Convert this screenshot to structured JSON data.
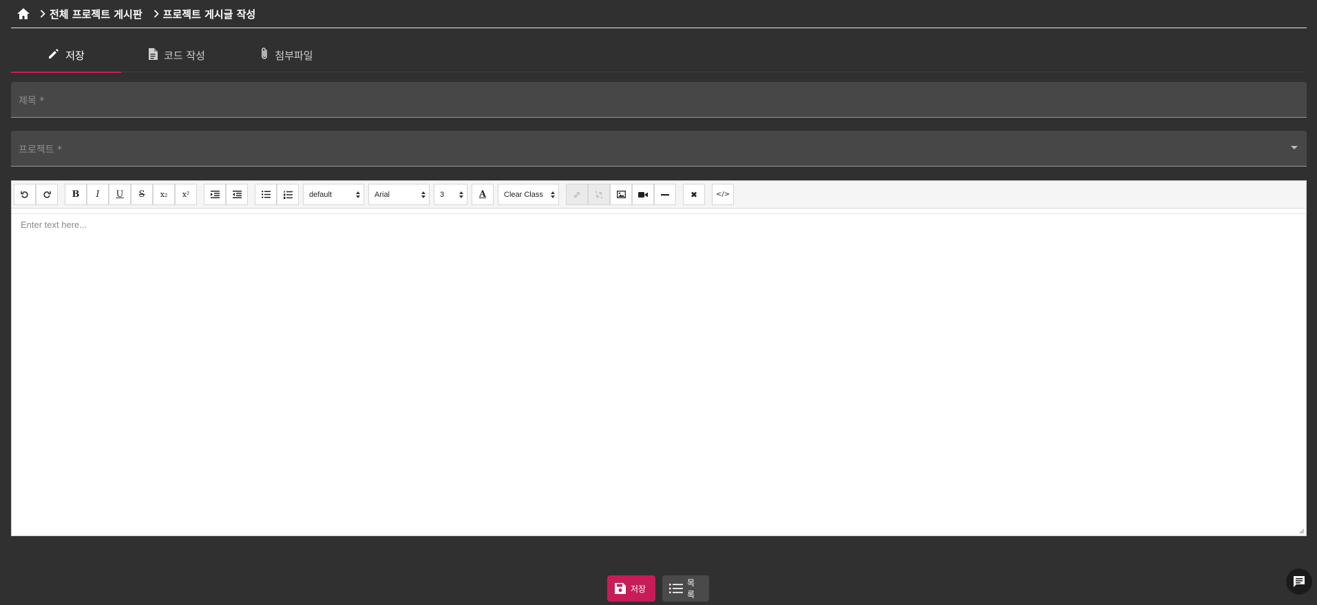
{
  "breadcrumb": {
    "items": [
      "전체 프로젝트 게시판",
      "프로젝트 게시글 작성"
    ]
  },
  "tabs": [
    {
      "label": "저장",
      "icon": "pencil-icon",
      "active": true
    },
    {
      "label": "코드 작성",
      "icon": "document-icon",
      "active": false
    },
    {
      "label": "첨부파일",
      "icon": "paperclip-icon",
      "active": false
    }
  ],
  "form": {
    "title_placeholder": "제목 *",
    "project_placeholder": "프로젝트 *"
  },
  "editor": {
    "style_select": "default",
    "font_select": "Arial",
    "size_select": "3",
    "class_select": "Clear Class",
    "placeholder": "Enter text here...",
    "toolbar_glyphs": {
      "bold": "B",
      "italic": "I",
      "underline": "U",
      "strike": "S",
      "subscript": "x₂",
      "superscript": "x²",
      "color": "A",
      "remove": "✖",
      "code": "</>"
    }
  },
  "actions": {
    "save_label": "저장",
    "list_label": "목록"
  },
  "colors": {
    "accent": "#c81c59",
    "background": "#303030",
    "field": "#474747"
  }
}
